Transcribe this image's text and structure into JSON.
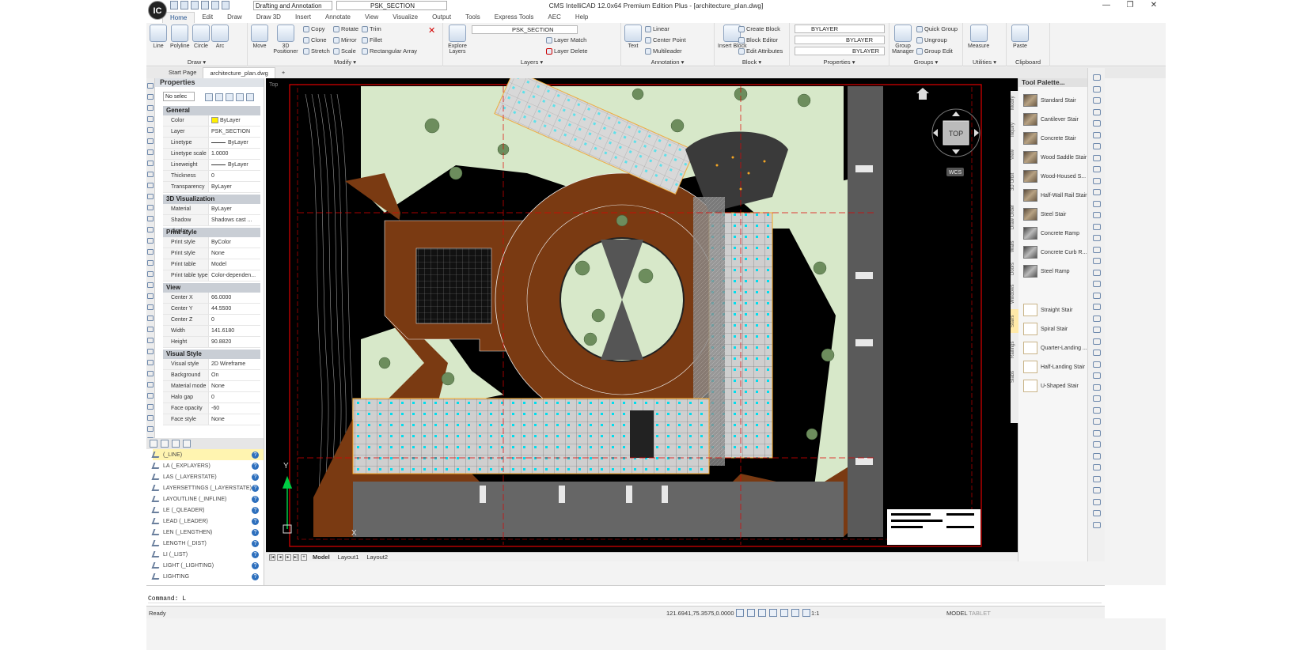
{
  "app": {
    "title": "CMS IntelliCAD 12.0x64 Premium Edition Plus  - [architecture_plan.dwg]",
    "workspace": "Drafting and Annotation",
    "current_layer": "PSK_SECTION",
    "logo_text": "IC"
  },
  "window_controls": {
    "minimize": "—",
    "maximize": "❐",
    "close": "✕"
  },
  "ribbon_tabs": [
    "Home",
    "Edit",
    "Draw",
    "Draw 3D",
    "Insert",
    "Annotate",
    "View",
    "Visualize",
    "Output",
    "Tools",
    "Express Tools",
    "AEC",
    "Help"
  ],
  "ribbon": {
    "draw": {
      "title": "Draw ▾",
      "line": "Line",
      "polyline": "Polyline",
      "circle": "Circle",
      "arc": "Arc"
    },
    "modify": {
      "title": "Modify ▾",
      "move": "Move",
      "positioner": "3D Positioner",
      "copy": "Copy",
      "rotate": "Rotate",
      "trim": "Trim",
      "clone": "Clone",
      "mirror": "Mirror",
      "fillet": "Fillet",
      "stretch": "Stretch",
      "scale": "Scale",
      "rect_array": "Rectangular Array"
    },
    "layers": {
      "title": "Layers ▾",
      "explore": "Explore Layers",
      "layer_name": "PSK_SECTION",
      "layer_match": "Layer Match",
      "layer_delete": "Layer Delete"
    },
    "annotation": {
      "title": "Annotation ▾",
      "text": "Text",
      "linear": "Linear",
      "center_point": "Center Point",
      "multileader": "Multileader"
    },
    "block": {
      "title": "Block ▾",
      "insert": "Insert Block",
      "create": "Create Block",
      "editor": "Block Editor",
      "edit_attr": "Edit Attributes"
    },
    "properties": {
      "title": "Properties ▾",
      "color": "BYLAYER",
      "linetype": "BYLAYER",
      "lineweight": "BYLAYER"
    },
    "groups": {
      "title": "Groups ▾",
      "manager": "Group Manager",
      "quick": "Quick Group",
      "ungroup": "Ungroup",
      "edit": "Group Edit"
    },
    "utilities": {
      "title": "Utilities ▾",
      "measure": "Measure"
    },
    "clipboard": {
      "title": "Clipboard",
      "paste": "Paste"
    }
  },
  "doc_tabs": [
    "Start Page",
    "architecture_plan.dwg"
  ],
  "doc_tab_add": "+",
  "properties_panel": {
    "title": "Properties",
    "selection": "No selec",
    "sections": [
      {
        "name": "General",
        "rows": [
          [
            "Color",
            "ByLayer"
          ],
          [
            "Layer",
            "PSK_SECTION"
          ],
          [
            "Linetype",
            "ByLayer"
          ],
          [
            "Linetype scale",
            "1.0000"
          ],
          [
            "Lineweight",
            "ByLayer"
          ],
          [
            "Thickness",
            "0"
          ],
          [
            "Transparency",
            "ByLayer"
          ]
        ]
      },
      {
        "name": "3D Visualization",
        "rows": [
          [
            "Material",
            "ByLayer"
          ],
          [
            "Shadow display",
            "Shadows cast ..."
          ]
        ]
      },
      {
        "name": "Print style",
        "rows": [
          [
            "Print style",
            "ByColor"
          ],
          [
            "Print style table",
            "None"
          ],
          [
            "Print table attac...",
            "Model"
          ],
          [
            "Print table type",
            "Color-dependen..."
          ]
        ]
      },
      {
        "name": "View",
        "rows": [
          [
            "Center X",
            "66.0000"
          ],
          [
            "Center Y",
            "44.5500"
          ],
          [
            "Center Z",
            "0"
          ],
          [
            "Width",
            "141.6180"
          ],
          [
            "Height",
            "90.8820"
          ]
        ]
      },
      {
        "name": "Visual Style",
        "rows": [
          [
            "Visual style",
            "2D Wireframe"
          ],
          [
            "Background",
            "On"
          ],
          [
            "Material mode",
            "None"
          ],
          [
            "Halo gap",
            "0"
          ],
          [
            "Face opacity",
            "-60"
          ],
          [
            "Face style",
            "None"
          ]
        ]
      }
    ]
  },
  "command_list": [
    "(_LINE)",
    "LA (_EXPLAYERS)",
    "LAS (_LAYERSTATE)",
    "LAYERSETTINGS (_LAYERSTATE)",
    "LAYOUTLINE (_INFLINE)",
    "LE (_QLEADER)",
    "LEAD (_LEADER)",
    "LEN (_LENGTHEN)",
    "LENGTH (_DIST)",
    "LI (_LIST)",
    "LIGHT (_LIGHTING)",
    "LIGHTING"
  ],
  "viewport": {
    "label": "Top",
    "viewcube": "TOP",
    "wcs": "WCS",
    "ucs_y": "Y",
    "ucs_x": "X"
  },
  "layout_tabs": [
    "Model",
    "Layout1",
    "Layout2"
  ],
  "tool_palette": {
    "title": "Tool Palette...",
    "items": [
      "Standard Stair",
      "Cantilever Stair",
      "Concrete Stair",
      "Wood Saddle Stair",
      "Wood-Housed S...",
      "Half-Wall Rail Stair",
      "Steel Stair",
      "Concrete Ramp",
      "Concrete Curb R...",
      "Steel Ramp",
      "Straight Stair",
      "Spiral Stair",
      "Quarter-Landing ...",
      "Half-Landing Stair",
      "U-Shaped Stair"
    ],
    "vertical_tabs": [
      "Modify",
      "Inquiry",
      "View",
      "3D Orbit",
      "Draw Order",
      "Walls",
      "Doors",
      "Windows",
      "Stairs",
      "Railings",
      "Slabs"
    ],
    "active_vertical_tab": "Stairs"
  },
  "command_line": {
    "prompt": "Command:  L"
  },
  "status": {
    "ready": "Ready",
    "coords": "121.6941,75.3575,0.0000",
    "scale": "1:1",
    "model": "MODEL",
    "tablet": "TABLET"
  },
  "colors": {
    "accent": "#1c4d8c",
    "layer_yellow": "#ffef00",
    "drawing_bg": "#000000",
    "courtyard_brown": "#7a3a12",
    "lawn": "#d7e8c9"
  }
}
